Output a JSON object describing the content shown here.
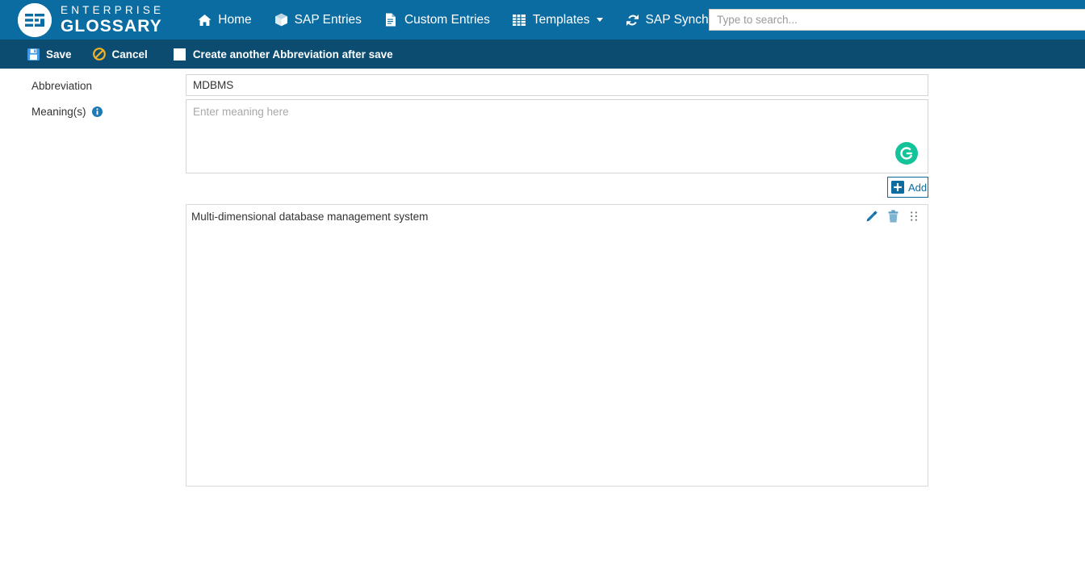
{
  "brand": {
    "line1": "ENTERPRISE",
    "line2": "GLOSSARY",
    "logo_icon": "glossary-logo-icon"
  },
  "nav": {
    "items": [
      {
        "label": "Home",
        "icon": "home-icon",
        "has_caret": false
      },
      {
        "label": "SAP Entries",
        "icon": "cube-icon",
        "has_caret": false
      },
      {
        "label": "Custom Entries",
        "icon": "document-icon",
        "has_caret": false
      },
      {
        "label": "Templates",
        "icon": "grid-icon",
        "has_caret": true
      },
      {
        "label": "SAP Synchronization",
        "icon": "sync-icon",
        "has_caret": true
      }
    ]
  },
  "search": {
    "placeholder": "Type to search...",
    "value": ""
  },
  "toolbar": {
    "save_label": "Save",
    "save_icon": "floppy-disk-icon",
    "cancel_label": "Cancel",
    "cancel_icon": "ban-circle-icon",
    "checkbox_label": "Create another Abbreviation after save",
    "checkbox_checked": false
  },
  "form": {
    "abbreviation_label": "Abbreviation",
    "abbreviation_value": "MDBMS",
    "abbreviation_placeholder": "",
    "meanings_label": "Meaning(s)",
    "meanings_info_icon": "info-circle-icon",
    "meaning_placeholder": "Enter meaning here",
    "meaning_value": "",
    "grammarly_icon": "grammarly-icon",
    "add_label": "Add",
    "add_icon": "plus-square-icon"
  },
  "meanings_list": {
    "rows": [
      {
        "text": "Multi-dimensional database management system",
        "edit_icon": "pencil-icon",
        "delete_icon": "trash-icon",
        "drag_icon": "drag-handle-icon"
      }
    ]
  },
  "colors": {
    "navbar": "#0a6ca0",
    "toolbar": "#0b4c70",
    "accent": "#0a6ca0",
    "grammarly_green": "#15c39a",
    "cancel_yellow": "#f0b323",
    "save_blue": "#3d9ae2"
  }
}
